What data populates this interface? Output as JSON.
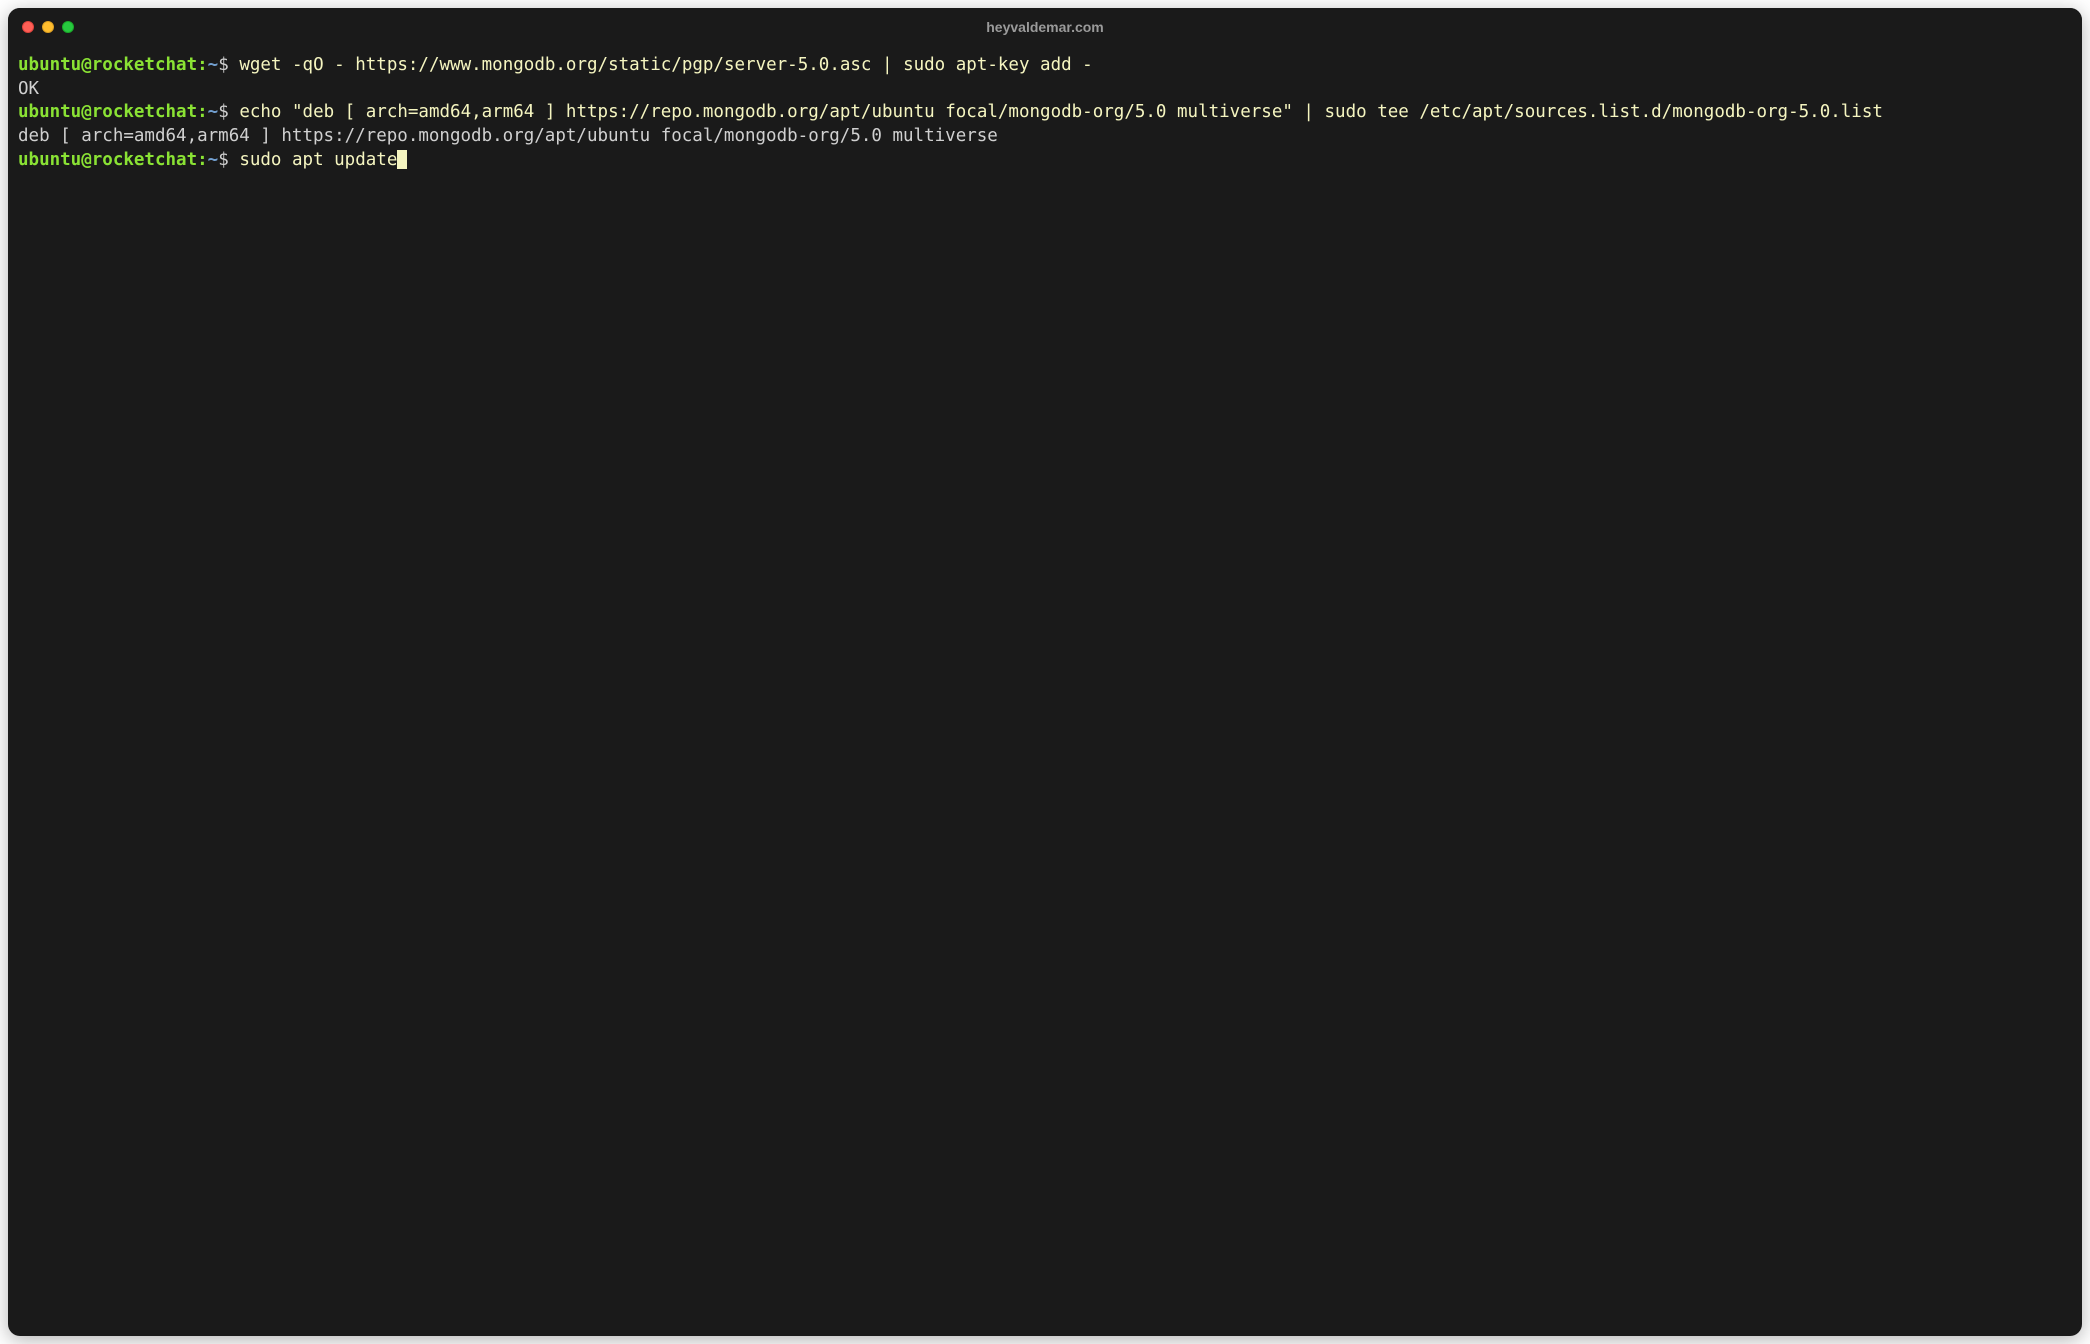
{
  "window": {
    "title": "heyvaldemar.com"
  },
  "prompt": {
    "user_host": "ubuntu@rocketchat",
    "separator": ":",
    "path": "~",
    "symbol": "$"
  },
  "lines": [
    {
      "type": "command",
      "text": "wget -qO - https://www.mongodb.org/static/pgp/server-5.0.asc | sudo apt-key add -"
    },
    {
      "type": "output",
      "text": "OK"
    },
    {
      "type": "command",
      "text": "echo \"deb [ arch=amd64,arm64 ] https://repo.mongodb.org/apt/ubuntu focal/mongodb-org/5.0 multiverse\" | sudo tee /etc/apt/sources.list.d/mongodb-org-5.0.list"
    },
    {
      "type": "output",
      "text": "deb [ arch=amd64,arm64 ] https://repo.mongodb.org/apt/ubuntu focal/mongodb-org/5.0 multiverse"
    },
    {
      "type": "command_active",
      "text": "sudo apt update"
    }
  ]
}
